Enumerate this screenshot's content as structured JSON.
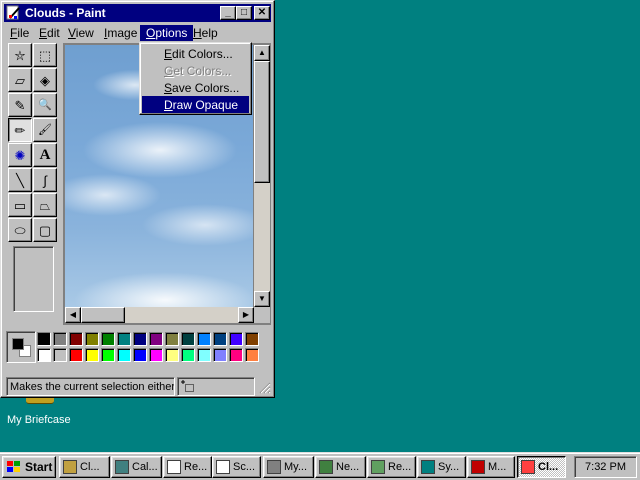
{
  "window": {
    "title": "Clouds - Paint",
    "controls": {
      "minimize": "_",
      "maximize": "□",
      "close": "✕"
    }
  },
  "menubar": [
    {
      "label": "File",
      "key": "F",
      "rest": "ile"
    },
    {
      "label": "Edit",
      "key": "E",
      "rest": "dit"
    },
    {
      "label": "View",
      "key": "V",
      "rest": "iew"
    },
    {
      "label": "Image",
      "key": "I",
      "rest": "mage"
    },
    {
      "label": "Options",
      "key": "O",
      "rest": "ptions",
      "active": true
    },
    {
      "label": "Help",
      "key": "H",
      "rest": "elp"
    }
  ],
  "options_menu": [
    {
      "label": "Edit Colors...",
      "key": "E",
      "rest": "dit Colors...",
      "enabled": true,
      "selected": false
    },
    {
      "label": "Get Colors...",
      "key": "G",
      "rest": "et Colors...",
      "enabled": false,
      "selected": false
    },
    {
      "label": "Save Colors...",
      "key": "S",
      "rest": "ave Colors...",
      "enabled": true,
      "selected": false
    },
    {
      "label": "Draw Opaque",
      "key": "D",
      "rest": "raw Opaque",
      "enabled": true,
      "selected": true
    }
  ],
  "tools": [
    {
      "name": "free-form-select-icon",
      "glyph": "⛦"
    },
    {
      "name": "rect-select-icon",
      "glyph": "⬚"
    },
    {
      "name": "eraser-icon",
      "glyph": "▱"
    },
    {
      "name": "fill-bucket-icon",
      "glyph": "◈"
    },
    {
      "name": "pick-color-icon",
      "glyph": "✎"
    },
    {
      "name": "magnifier-icon",
      "glyph": "🔍"
    },
    {
      "name": "pencil-icon",
      "glyph": "✏",
      "pressed": true
    },
    {
      "name": "brush-icon",
      "glyph": "🖌"
    },
    {
      "name": "airbrush-icon",
      "glyph": "✺"
    },
    {
      "name": "text-icon",
      "glyph": "A"
    },
    {
      "name": "line-icon",
      "glyph": "╲"
    },
    {
      "name": "curve-icon",
      "glyph": "∫"
    },
    {
      "name": "rectangle-icon",
      "glyph": "▭"
    },
    {
      "name": "polygon-icon",
      "glyph": "⏢"
    },
    {
      "name": "ellipse-icon",
      "glyph": "⬭"
    },
    {
      "name": "rounded-rect-icon",
      "glyph": "▢"
    }
  ],
  "colors": {
    "foreground": "#000000",
    "background": "#ffffff",
    "palette_top": [
      "#000000",
      "#808080",
      "#800000",
      "#808000",
      "#008000",
      "#008080",
      "#000080",
      "#800080",
      "#808040",
      "#004040",
      "#0080ff",
      "#004080",
      "#4000ff",
      "#804000"
    ],
    "palette_bottom": [
      "#ffffff",
      "#c0c0c0",
      "#ff0000",
      "#ffff00",
      "#00ff00",
      "#00ffff",
      "#0000ff",
      "#ff00ff",
      "#ffff80",
      "#00ff80",
      "#80ffff",
      "#8080ff",
      "#ff0080",
      "#ff8040"
    ]
  },
  "status": {
    "text": "Makes the current selection either"
  },
  "desktop": {
    "briefcase_label": "My Briefcase"
  },
  "taskbar": {
    "start_label": "Start",
    "buttons": [
      {
        "label": "Cl...",
        "icon": "clipboard-icon",
        "active": false
      },
      {
        "label": "Cal...",
        "icon": "calculator-icon",
        "active": false
      },
      {
        "label": "Re...",
        "icon": "document-icon",
        "active": false
      },
      {
        "label": "Sc...",
        "icon": "notepad-icon",
        "active": false
      },
      {
        "label": "My...",
        "icon": "my-computer-icon",
        "active": false
      },
      {
        "label": "Ne...",
        "icon": "network-icon",
        "active": false
      },
      {
        "label": "Re...",
        "icon": "recycle-icon",
        "active": false
      },
      {
        "label": "Sy...",
        "icon": "system-icon",
        "active": false
      },
      {
        "label": "M...",
        "icon": "media-icon",
        "active": false
      },
      {
        "label": "Cl...",
        "icon": "paint-icon",
        "active": true
      }
    ],
    "clock": "7:32 PM"
  }
}
